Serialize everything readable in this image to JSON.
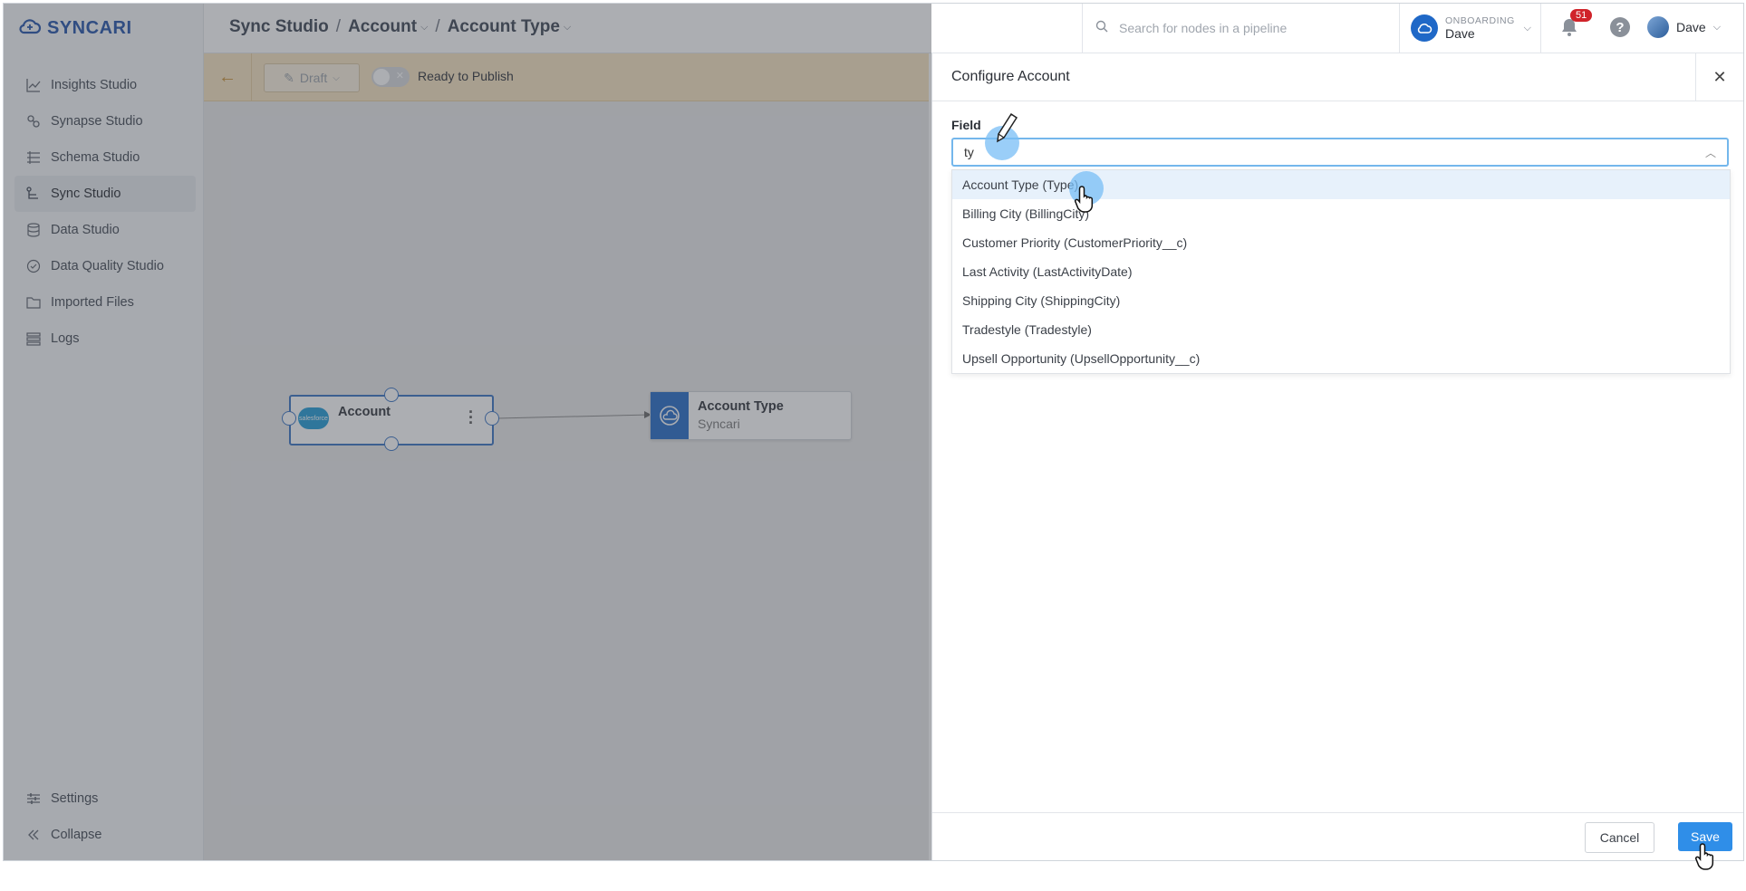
{
  "app": {
    "logo_text": "SYNCARI"
  },
  "sidebar": {
    "items": [
      {
        "label": "Insights Studio",
        "icon": "chart-icon"
      },
      {
        "label": "Synapse Studio",
        "icon": "synapse-icon"
      },
      {
        "label": "Schema Studio",
        "icon": "schema-icon"
      },
      {
        "label": "Sync Studio",
        "icon": "sync-icon",
        "active": true
      },
      {
        "label": "Data Studio",
        "icon": "database-icon"
      },
      {
        "label": "Data Quality Studio",
        "icon": "quality-icon"
      },
      {
        "label": "Imported Files",
        "icon": "folder-icon"
      },
      {
        "label": "Logs",
        "icon": "logs-icon"
      }
    ],
    "bottom": [
      {
        "label": "Settings",
        "icon": "sliders-icon"
      },
      {
        "label": "Collapse",
        "icon": "double-chevron-left-icon"
      }
    ]
  },
  "header": {
    "breadcrumb": [
      "Sync Studio",
      "Account",
      "Account Type"
    ],
    "search_placeholder": "Search for nodes in a pipeline",
    "org_label": "ONBOARDING",
    "org_name": "Dave",
    "notifications": "51",
    "help": "?",
    "user_name": "Dave"
  },
  "toolbar": {
    "draft_label": "Draft",
    "toggle_x": "✕",
    "ready_label": "Ready to Publish"
  },
  "canvas": {
    "source_node": {
      "title": "Account",
      "logo_text": "salesforce"
    },
    "target_node": {
      "title": "Account Type",
      "subtitle": "Syncari"
    }
  },
  "panel": {
    "title": "Configure Account",
    "field_label": "Field",
    "field_value": "ty",
    "options": [
      "Account Type (Type)",
      "Billing City (BillingCity)",
      "Customer Priority (CustomerPriority__c)",
      "Last Activity (LastActivityDate)",
      "Shipping City (ShippingCity)",
      "Tradestyle (Tradestyle)",
      "Upsell Opportunity (UpsellOpportunity__c)"
    ],
    "cancel_label": "Cancel",
    "save_label": "Save"
  },
  "colors": {
    "brand": "#1e4fa8",
    "accent": "#2f8ee8",
    "toolbar_bg": "#f7e3c0",
    "badge": "#d0232a"
  }
}
